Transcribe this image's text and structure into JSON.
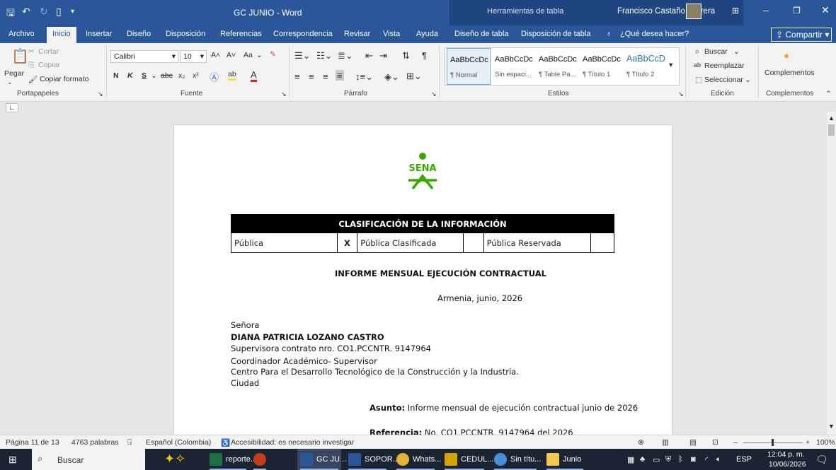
{
  "window": {
    "doc_title": "GC JUNIO  -  Word",
    "contextual_title": "Herramientas de tabla",
    "user_name": "Francisco Castaño Herrera",
    "colors": {
      "title_bar": "#2b579a",
      "ribbon": "#f3f3f3",
      "taskbar": "#1c2433"
    }
  },
  "tabs": {
    "items": [
      "Archivo",
      "Inicio",
      "Insertar",
      "Diseño",
      "Disposición",
      "Referencias",
      "Correspondencia",
      "Revisar",
      "Vista",
      "Ayuda",
      "Diseño de tabla",
      "Disposición de tabla"
    ],
    "active": "Inicio",
    "tell_me": "¿Qué desea hacer?",
    "share": "Compartir"
  },
  "ribbon": {
    "clipboard": {
      "paste": "Pegar",
      "cut": "Cortar",
      "copy": "Copiar",
      "format_painter": "Copiar formato",
      "label": "Portapapeles"
    },
    "font": {
      "name": "Calibri",
      "size": "10",
      "change_case": "Aa",
      "bold": "N",
      "italic": "K",
      "underline": "S",
      "strike": "abc",
      "label": "Fuente"
    },
    "paragraph": {
      "label": "Párrafo"
    },
    "styles": {
      "items": [
        {
          "sample": "AaBbCcDc",
          "name": "¶ Normal"
        },
        {
          "sample": "AaBbCcDc",
          "name": "Sin espaci..."
        },
        {
          "sample": "AaBbCcDc",
          "name": "¶ Table Pa..."
        },
        {
          "sample": "AaBbCcDc",
          "name": "¶ Título 1"
        },
        {
          "sample": "AaBbCcD",
          "name": "¶ Título 2"
        }
      ],
      "label": "Estilos"
    },
    "editing": {
      "find": "Buscar",
      "replace": "Reemplazar",
      "select": "Seleccionar",
      "label": "Edición"
    },
    "addins": {
      "button": "Complementos",
      "label": "Complementos"
    }
  },
  "document": {
    "logo_text": "SENA",
    "table": {
      "header": "CLASIFICACIÓN DE LA INFORMACIÓN",
      "cells": [
        "Pública",
        "X",
        "Pública Clasificada",
        "",
        "Pública Reservada",
        ""
      ]
    },
    "heading": "INFORME MENSUAL EJECUCIÓN CONTRACTUAL",
    "place_date": "Armenia, junio, 2026",
    "salutation": "Señora",
    "recipient_name": "DIANA PATRICIA LOZANO CASTRO",
    "recipient_role": "Supervisora contrato nro. CO1.PCCNTR. 9147964",
    "recipient_role2": "Coordinador Académico- Supervisor",
    "recipient_org": "Centro Para el Desarrollo Tecnológico de la Construcción y la Industria.",
    "city": "Ciudad",
    "subject_label": "Asunto:",
    "subject_text": "Informe mensual de ejecución contractual junio de 2026",
    "reference_label": "Referencia:",
    "reference_text": "No.  CO1.PCCNTR. 9147964 del 2026"
  },
  "statusbar": {
    "page": "Página 11 de 13",
    "words": "4763 palabras",
    "language": "Español (Colombia)",
    "accessibility": "Accesibilidad: es necesario investigar",
    "zoom": "100%"
  },
  "taskbar": {
    "search": "Buscar",
    "apps": [
      "reporte...",
      "GC JU...",
      "SOPOR...",
      "Whats...",
      "CEDUL...",
      "Sin títu...",
      "Junio"
    ],
    "lang": "ESP",
    "time": "12:04 p. m.",
    "date": "10/06/2026"
  }
}
